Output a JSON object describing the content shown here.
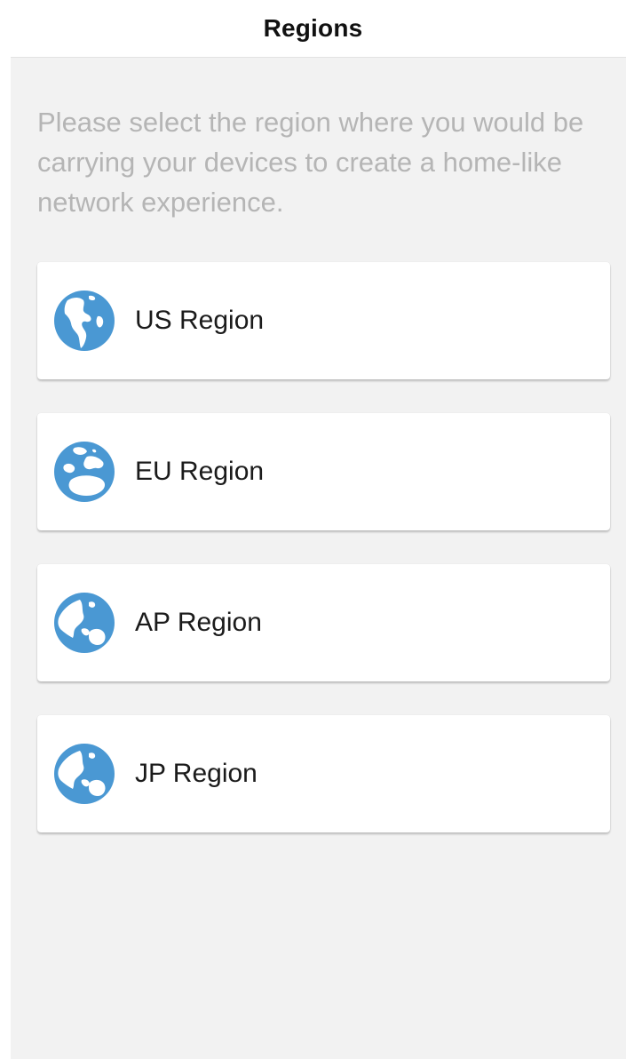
{
  "header": {
    "title": "Regions"
  },
  "description": "Please select the region where you would be carrying your devices  to create a home-like network experience.",
  "colors": {
    "globe": "#4a98d3",
    "background": "#f2f2f2",
    "description_text": "#b5b5b5"
  },
  "regions": [
    {
      "label": "US Region",
      "icon": "globe-americas-icon"
    },
    {
      "label": "EU Region",
      "icon": "globe-europe-icon"
    },
    {
      "label": "AP Region",
      "icon": "globe-asia-pacific-icon"
    },
    {
      "label": "JP Region",
      "icon": "globe-asia-pacific-icon"
    }
  ]
}
